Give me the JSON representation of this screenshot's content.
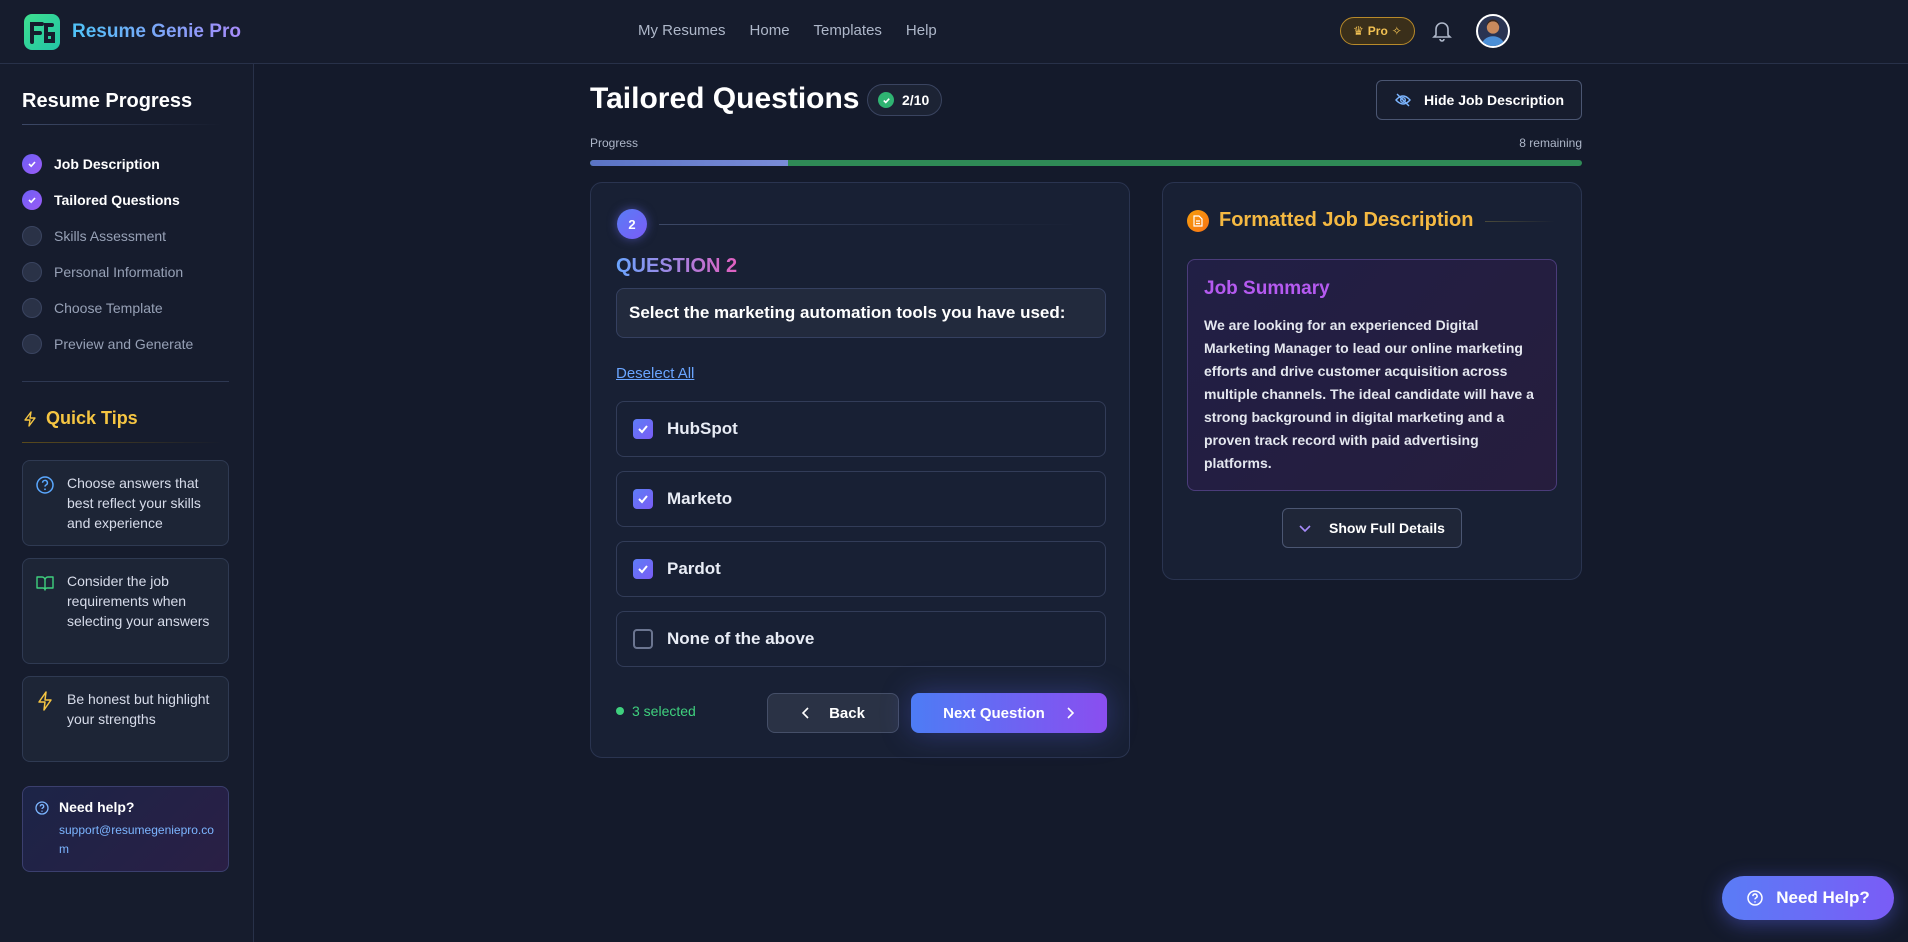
{
  "app": {
    "brand": "Resume Genie Pro"
  },
  "nav": {
    "items": [
      "My Resumes",
      "Home",
      "Templates",
      "Help"
    ]
  },
  "header": {
    "pro_label": "Pro"
  },
  "sidebar": {
    "title": "Resume Progress",
    "steps": [
      {
        "label": "Job Description",
        "done": true
      },
      {
        "label": "Tailored Questions",
        "done": true
      },
      {
        "label": "Skills Assessment",
        "done": false
      },
      {
        "label": "Personal Information",
        "done": false
      },
      {
        "label": "Choose Template",
        "done": false
      },
      {
        "label": "Preview and Generate",
        "done": false
      }
    ],
    "tips_title": "Quick Tips",
    "tips": [
      {
        "icon": "question-circle-icon",
        "text": "Choose answers that best reflect your skills and experience"
      },
      {
        "icon": "book-open-icon",
        "text": "Consider the job requirements when selecting your answers"
      },
      {
        "icon": "lightning-icon",
        "text": "Be honest but highlight your strengths"
      }
    ],
    "help": {
      "title": "Need help?",
      "email": "support@resumegeniepro.com"
    }
  },
  "main": {
    "title": "Tailored Questions",
    "count_badge": "2/10",
    "hide_button": "Hide Job Description",
    "progress_label": "Progress",
    "progress_remaining": "8 remaining",
    "progress_fraction": 0.2
  },
  "question": {
    "number": "2",
    "heading": "QUESTION 2",
    "text": "Select the marketing automation tools you have used:",
    "deselect_label": "Deselect All",
    "options": [
      {
        "label": "HubSpot",
        "checked": true
      },
      {
        "label": "Marketo",
        "checked": true
      },
      {
        "label": "Pardot",
        "checked": true
      },
      {
        "label": "None of the above",
        "checked": false
      }
    ],
    "selected_count": "3 selected",
    "back_label": "Back",
    "next_label": "Next Question"
  },
  "job_description": {
    "title": "Formatted Job Description",
    "summary_title": "Job Summary",
    "summary_text": "We are looking for an experienced Digital Marketing Manager to lead our online marketing efforts and drive customer acquisition across multiple channels. The ideal candidate will have a strong background in digital marketing and a proven track record with paid advertising platforms.",
    "show_button": "Show Full Details"
  },
  "fab": {
    "label": "Need Help?"
  },
  "colors": {
    "accent": "#6d5ef5",
    "success": "#3fd07e",
    "warning": "#f5c542"
  }
}
